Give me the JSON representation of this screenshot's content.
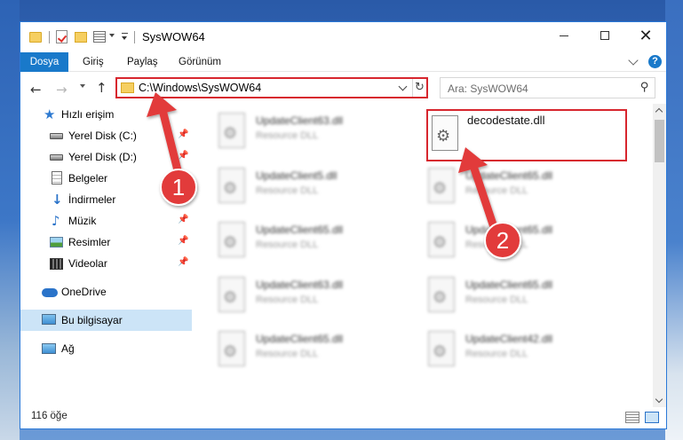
{
  "window": {
    "title": "SysWOW64",
    "minimize_label": "",
    "close_glyph": "✕"
  },
  "ribbon": {
    "tabs": [
      "Dosya",
      "Giriş",
      "Paylaş",
      "Görünüm"
    ],
    "help_glyph": "?"
  },
  "nav": {
    "back_glyph": "←",
    "forward_glyph": "→",
    "up_glyph": "↑"
  },
  "address": {
    "path": "C:\\Windows\\SysWOW64",
    "refresh_glyph": "↻"
  },
  "search": {
    "placeholder": "Ara: SysWOW64",
    "icon_glyph": "⚲"
  },
  "sidebar": {
    "items": [
      {
        "label": "Hızlı erişim",
        "icon": "star-icon",
        "pinned": false
      },
      {
        "label": "Yerel Disk (C:)",
        "icon": "disk-icon",
        "pinned": true
      },
      {
        "label": "Yerel Disk (D:)",
        "icon": "disk-icon",
        "pinned": true
      },
      {
        "label": "Belgeler",
        "icon": "documents-icon",
        "pinned": true
      },
      {
        "label": "İndirmeler",
        "icon": "download-icon",
        "pinned": true
      },
      {
        "label": "Müzik",
        "icon": "music-icon",
        "pinned": true
      },
      {
        "label": "Resimler",
        "icon": "pictures-icon",
        "pinned": true
      },
      {
        "label": "Videolar",
        "icon": "videos-icon",
        "pinned": true
      },
      {
        "label": "OneDrive",
        "icon": "onedrive-icon",
        "pinned": false
      },
      {
        "label": "Bu bilgisayar",
        "icon": "this-pc-icon",
        "pinned": false,
        "selected": true
      },
      {
        "label": "Ağ",
        "icon": "network-icon",
        "pinned": false
      }
    ],
    "pin_glyph": "📌"
  },
  "files": {
    "highlighted": {
      "name": "decodestate.dll"
    },
    "left_column": [
      {
        "name": "UpdateClient63.dll",
        "type": "Resource DLL"
      },
      {
        "name": "UpdateClient5.dll",
        "type": "Resource DLL"
      },
      {
        "name": "UpdateClient65.dll",
        "type": "Resource DLL"
      },
      {
        "name": "UpdateClient63.dll",
        "type": "Resource DLL"
      },
      {
        "name": "UpdateClient65.dll",
        "type": "Resource DLL"
      }
    ],
    "right_column": [
      {
        "name": "UpdateClient65.dll",
        "type": "Resource DLL"
      },
      {
        "name": "UpdateClient65.dll",
        "type": "Resource DLL"
      },
      {
        "name": "UpdateClient65.dll",
        "type": "Resource DLL"
      },
      {
        "name": "UpdateClient42.dll",
        "type": "Resource DLL"
      }
    ]
  },
  "status": {
    "count": "116 öğe"
  },
  "annotations": {
    "step1": "1",
    "step2": "2",
    "arrow_color": "#e23b3b",
    "highlight_color": "#d7262e"
  }
}
